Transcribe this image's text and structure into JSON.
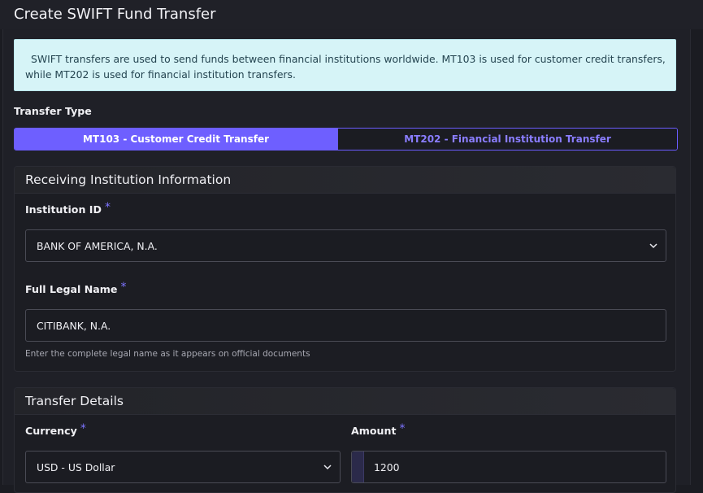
{
  "page": {
    "title": "Create SWIFT Fund Transfer"
  },
  "info": {
    "text": "SWIFT transfers are used to send funds between financial institutions worldwide. MT103 is used for customer credit transfers, while MT202 is used for financial institution transfers."
  },
  "transfer_type": {
    "label": "Transfer Type",
    "options": [
      {
        "label": "MT103 - Customer Credit Transfer",
        "selected": true
      },
      {
        "label": "MT202 - Financial Institution Transfer",
        "selected": false
      }
    ]
  },
  "receiving_institution": {
    "title": "Receiving Institution Information",
    "institution_id": {
      "label": "Institution ID",
      "required_mark": "*",
      "value": "BANK OF AMERICA, N.A."
    },
    "full_legal_name": {
      "label": "Full Legal Name",
      "required_mark": "*",
      "value": "CITIBANK, N.A.",
      "helper": "Enter the complete legal name as it appears on official documents"
    }
  },
  "transfer_details": {
    "title": "Transfer Details",
    "currency": {
      "label": "Currency",
      "required_mark": "*",
      "value": "USD - US Dollar"
    },
    "amount": {
      "label": "Amount",
      "required_mark": "*",
      "value": "1200"
    }
  },
  "icons": {
    "dropdown": "chevron-down-icon"
  },
  "colors": {
    "accent": "#6e5fff",
    "info_bg": "#d6f4f7",
    "background": "#1b1c22"
  }
}
